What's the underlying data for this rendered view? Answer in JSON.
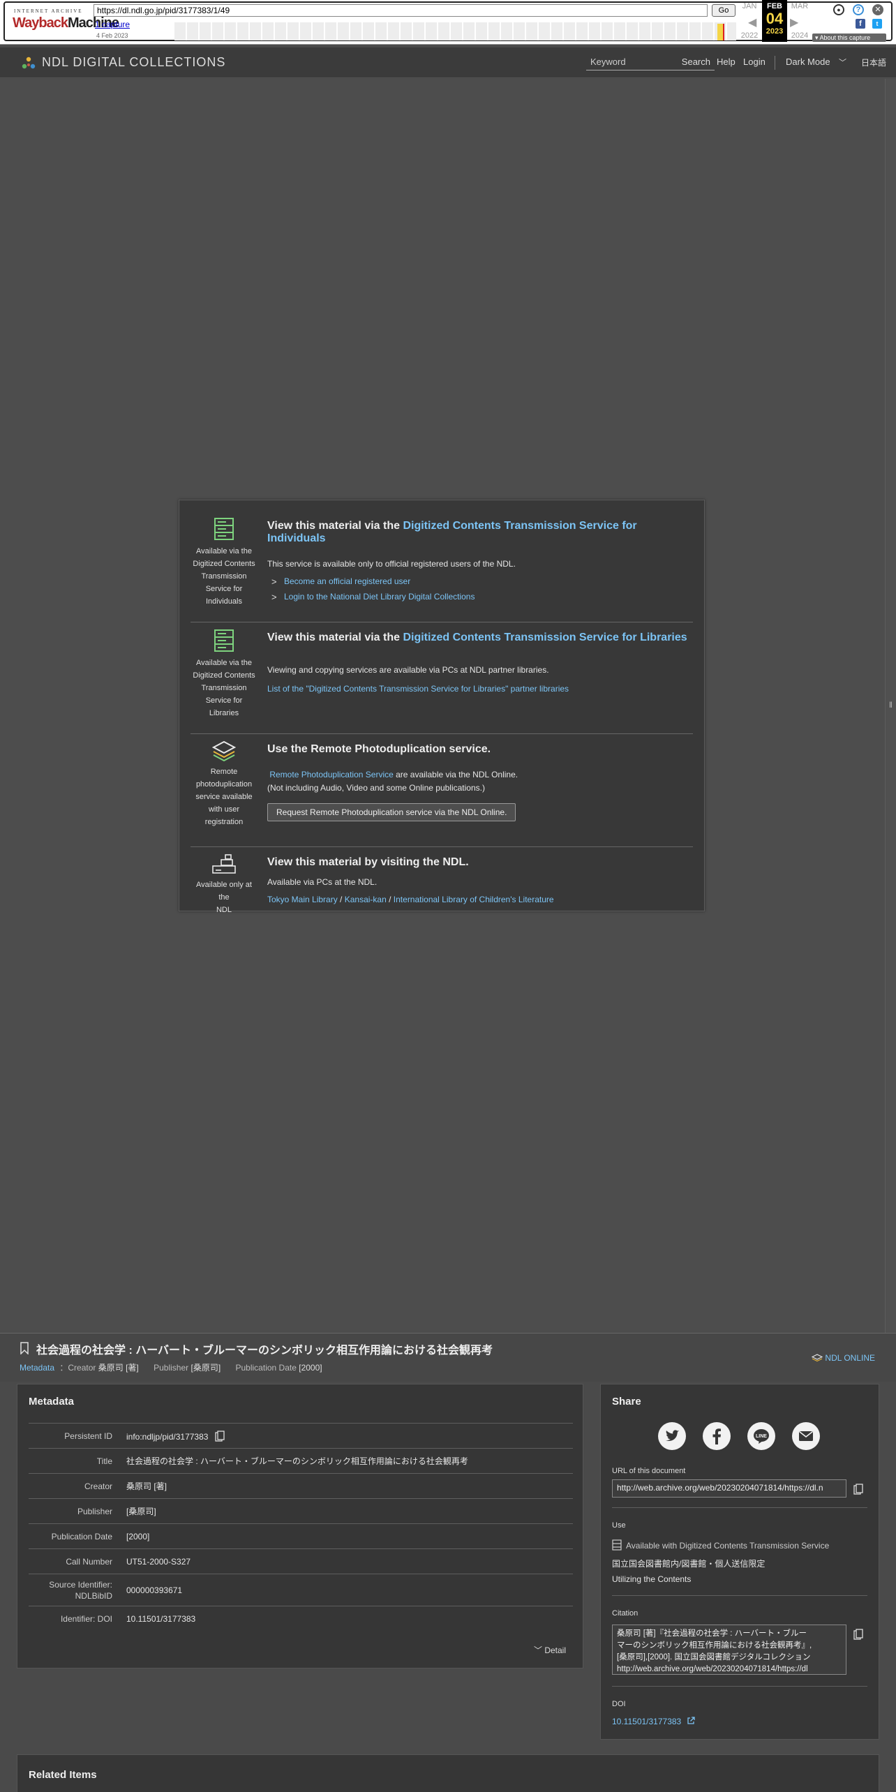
{
  "wayback": {
    "logo_top": "INTERNET ARCHIVE",
    "logo_way": "Wayback",
    "logo_machine": "Machine",
    "url": "https://dl.ndl.go.jp/pid/3177383/1/49",
    "go_label": "Go",
    "captures": "1 capture",
    "capture_date": "4 Feb 2023",
    "prev_month": "JAN",
    "cur_month": "FEB",
    "next_month": "MAR",
    "cur_day": "04",
    "prev_year": "2022",
    "cur_year": "2023",
    "next_year": "2024",
    "about": "About this capture"
  },
  "header": {
    "brand": "NDL DIGITAL COLLECTIONS",
    "search_placeholder": "Keyword",
    "search_button": "Search",
    "help": "Help",
    "login": "Login",
    "dark_mode": "Dark Mode",
    "language": "日本語"
  },
  "access": {
    "individuals": {
      "caption": [
        "Available via the",
        "Digitized Contents",
        "Transmission",
        "Service for",
        "Individuals"
      ],
      "heading_prefix": "View this material via the ",
      "heading_link": "Digitized Contents Transmission Service for Individuals",
      "text": "This service is available only to official registered users of the NDL.",
      "link1": "Become an official registered user",
      "link2": "Login to the National Diet Library Digital Collections"
    },
    "libraries": {
      "caption": [
        "Available via the",
        "Digitized Contents",
        "Transmission",
        "Service for Libraries"
      ],
      "heading_prefix": "View this material via the ",
      "heading_link": "Digitized Contents Transmission Service for Libraries",
      "text": "Viewing and copying services are available via PCs at NDL partner libraries.",
      "link": "List of the \"Digitized Contents Transmission Service for Libraries\" partner libraries"
    },
    "remote": {
      "caption": [
        "Remote",
        "photoduplication",
        "service available",
        "with user",
        "registration"
      ],
      "heading": "Use the Remote Photoduplication service.",
      "link": "Remote Photoduplication Service",
      "text1": " are available via the NDL Online.",
      "text2": "(Not including Audio, Video and some Online publications.)",
      "button": "Request Remote Photoduplication service via the NDL Online."
    },
    "visit": {
      "caption": [
        "Available only at the",
        "NDL"
      ],
      "heading": "View this material by visiting the NDL.",
      "text": "Available via PCs at the NDL.",
      "link1": "Tokyo Main Library",
      "sep": " / ",
      "link2": "Kansai-kan",
      "link3": "International Library of Children's Literature"
    }
  },
  "titlebar": {
    "title": "社会過程の社会学 : ハーバート・ブルーマーのシンボリック相互作用論における社会観再考",
    "metadata_link": "Metadata",
    "creator_label": "：Creator",
    "creator": "桑原司 [著]",
    "publisher_label": "Publisher",
    "publisher": "[桑原司]",
    "date_label": "Publication Date",
    "date": "[2000]",
    "ndl_online": "NDL ONLINE"
  },
  "metadata": {
    "heading": "Metadata",
    "rows": [
      {
        "k": "Persistent ID",
        "v": "info:ndljp/pid/3177383"
      },
      {
        "k": "Title",
        "v": "社会過程の社会学 : ハーバート・ブルーマーのシンボリック相互作用論における社会観再考"
      },
      {
        "k": "Creator",
        "v": "桑原司 [著]"
      },
      {
        "k": "Publisher",
        "v": "[桑原司]"
      },
      {
        "k": "Publication Date",
        "v": "[2000]"
      },
      {
        "k": "Call Number",
        "v": "UT51-2000-S327"
      },
      {
        "k": "Source Identifier: NDLBibID",
        "v": "000000393671"
      },
      {
        "k": "Identifier: DOI",
        "v": "10.11501/3177383"
      }
    ],
    "detail": "Detail"
  },
  "share": {
    "heading": "Share",
    "url_label": "URL of this document",
    "url_value": "http://web.archive.org/web/20230204071814/https://dl.n",
    "use_label": "Use",
    "use_service": "Available with Digitized Contents Transmission Service",
    "use_scope": "国立国会図書館内/図書館・個人送信限定",
    "use_link": "Utilizing the Contents",
    "citation_label": "Citation",
    "citation_line1": "桑原司 [著]『社会過程の社会学 : ハーバート・ブルー",
    "citation_line2": "マーのシンボリック相互作用論における社会観再考』,",
    "citation_line3": "[桑原司],[2000]. 国立国会図書館デジタルコレクション",
    "citation_line4": "http://web.archive.org/web/20230204071814/https://dl",
    "doi_label": "DOI",
    "doi_value": "10.11501/3177383"
  },
  "related": {
    "heading": "Related Items"
  }
}
